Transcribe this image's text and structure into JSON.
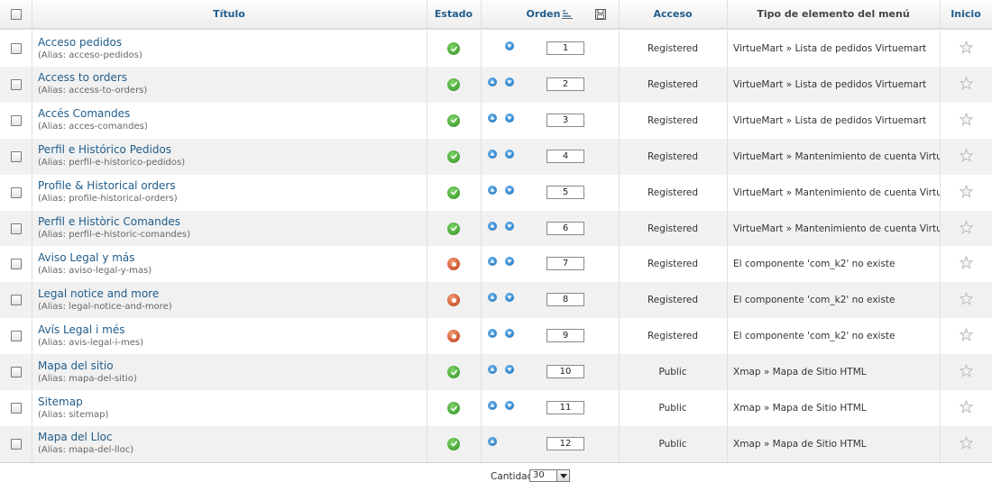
{
  "header": {
    "titulo": "Título",
    "estado": "Estado",
    "orden": "Orden",
    "acceso": "Acceso",
    "tipo": "Tipo de elemento del menú",
    "inicio": "Inicio"
  },
  "alias_prefix": "(Alias: ",
  "rows": [
    {
      "title": "Acceso pedidos",
      "alias": "acceso-pedidos",
      "status": "published",
      "up": false,
      "down": true,
      "order": "1",
      "access": "Registered",
      "type": "VirtueMart » Lista de pedidos Virtuemart"
    },
    {
      "title": "Access to orders",
      "alias": "access-to-orders",
      "status": "published",
      "up": true,
      "down": true,
      "order": "2",
      "access": "Registered",
      "type": "VirtueMart » Lista de pedidos Virtuemart"
    },
    {
      "title": "Accés Comandes",
      "alias": "acces-comandes",
      "status": "published",
      "up": true,
      "down": true,
      "order": "3",
      "access": "Registered",
      "type": "VirtueMart » Lista de pedidos Virtuemart"
    },
    {
      "title": "Perfil e Histórico Pedidos",
      "alias": "perfil-e-historico-pedidos",
      "status": "published",
      "up": true,
      "down": true,
      "order": "4",
      "access": "Registered",
      "type": "VirtueMart » Mantenimiento de cuenta VirtueMarte"
    },
    {
      "title": "Profile & Historical orders",
      "alias": "profile-historical-orders",
      "status": "published",
      "up": true,
      "down": true,
      "order": "5",
      "access": "Registered",
      "type": "VirtueMart » Mantenimiento de cuenta VirtueMarte"
    },
    {
      "title": "Perfil e Històric Comandes",
      "alias": "perfil-e-historic-comandes",
      "status": "published",
      "up": true,
      "down": true,
      "order": "6",
      "access": "Registered",
      "type": "VirtueMart » Mantenimiento de cuenta VirtueMarte"
    },
    {
      "title": "Aviso Legal y más",
      "alias": "aviso-legal-y-mas",
      "status": "unpublished",
      "up": true,
      "down": true,
      "order": "7",
      "access": "Registered",
      "type": "El componente 'com_k2' no existe"
    },
    {
      "title": "Legal notice and more",
      "alias": "legal-notice-and-more",
      "status": "unpublished",
      "up": true,
      "down": true,
      "order": "8",
      "access": "Registered",
      "type": "El componente 'com_k2' no existe"
    },
    {
      "title": "Avís Legal i més",
      "alias": "avis-legal-i-mes",
      "status": "unpublished",
      "up": true,
      "down": true,
      "order": "9",
      "access": "Registered",
      "type": "El componente 'com_k2' no existe"
    },
    {
      "title": "Mapa del sitio",
      "alias": "mapa-del-sitio",
      "status": "published",
      "up": true,
      "down": true,
      "order": "10",
      "access": "Public",
      "type": "Xmap » Mapa de Sitio HTML"
    },
    {
      "title": "Sitemap",
      "alias": "sitemap",
      "status": "published",
      "up": true,
      "down": true,
      "order": "11",
      "access": "Public",
      "type": "Xmap » Mapa de Sitio HTML"
    },
    {
      "title": "Mapa del Lloc",
      "alias": "mapa-del-lloc",
      "status": "published",
      "up": true,
      "down": false,
      "order": "12",
      "access": "Public",
      "type": "Xmap » Mapa de Sitio HTML"
    }
  ],
  "footer": {
    "cantidad_label": "Cantidad",
    "cantidad_value": "30"
  },
  "colors": {
    "link": "#1f5c8a",
    "published": "#2f8e1e",
    "unpublished": "#b8360f",
    "row_alt": "#f1f1f1"
  }
}
